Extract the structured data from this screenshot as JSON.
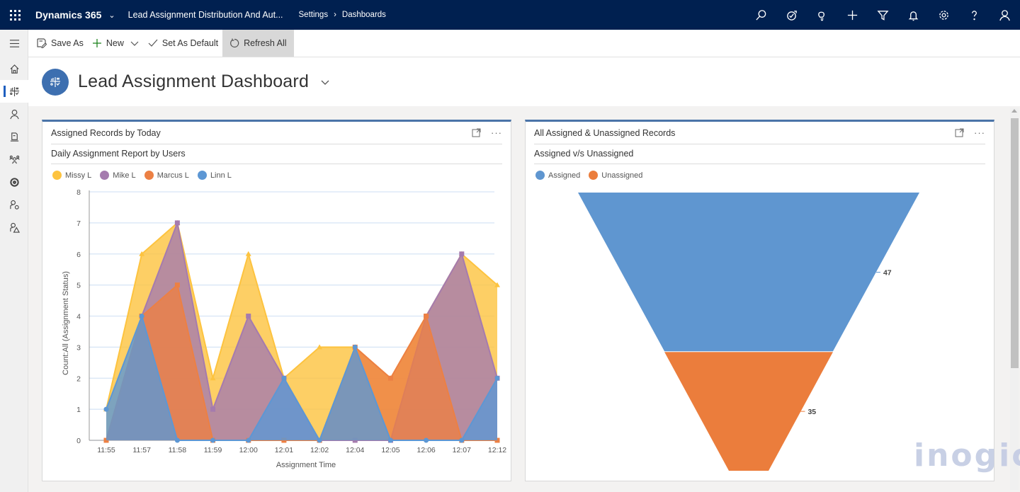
{
  "topbar": {
    "app_name": "Dynamics 365",
    "app_title": "Lead Assignment Distribution And Aut...",
    "breadcrumb": [
      "Settings",
      "Dashboards"
    ],
    "icons": [
      "search-icon",
      "task-icon",
      "lightbulb-icon",
      "plus-icon",
      "filter-icon",
      "bell-icon",
      "gear-icon",
      "help-icon",
      "user-icon"
    ]
  },
  "leftnav": {
    "items": [
      "hamburger-icon",
      "home-icon",
      "dashboard-icon",
      "contact-icon",
      "document-icon",
      "team-icon",
      "security-icon",
      "user-settings-icon",
      "user-warning-icon"
    ]
  },
  "commandbar": {
    "save_as": "Save As",
    "new": "New",
    "set_default": "Set As Default",
    "refresh_all": "Refresh All"
  },
  "header": {
    "title": "Lead Assignment Dashboard"
  },
  "panels": [
    {
      "title": "Assigned Records by Today",
      "subtitle": "Daily Assignment Report by Users"
    },
    {
      "title": "All Assigned & Unassigned Records",
      "subtitle": "Assigned v/s Unassigned"
    }
  ],
  "watermark": "inogic",
  "chart_data": [
    {
      "type": "area",
      "title": "Daily Assignment Report by Users",
      "xlabel": "Assignment Time",
      "ylabel": "Count:All (Assignment Status)",
      "ylim": [
        0,
        8
      ],
      "yticks": [
        0,
        1,
        2,
        3,
        4,
        5,
        6,
        7,
        8
      ],
      "grid": true,
      "legend_position": "top-left",
      "categories": [
        "11:55",
        "11:57",
        "11:58",
        "11:59",
        "12:00",
        "12:01",
        "12:02",
        "12:04",
        "12:05",
        "12:06",
        "12:07",
        "12:12"
      ],
      "series": [
        {
          "name": "Missy L",
          "color": "#fdc33f",
          "marker": "triangle",
          "values": [
            1,
            6,
            7,
            2,
            6,
            2,
            3,
            3,
            2,
            4,
            6,
            5
          ]
        },
        {
          "name": "Mike L",
          "color": "#a57bae",
          "marker": "square",
          "values": [
            0,
            4,
            7,
            1,
            4,
            2,
            0,
            0,
            0,
            4,
            6,
            2
          ]
        },
        {
          "name": "Marcus L",
          "color": "#ec8044",
          "marker": "square",
          "values": [
            0,
            4,
            5,
            0,
            0,
            0,
            0,
            3,
            2,
            4,
            0,
            0
          ]
        },
        {
          "name": "Linn L",
          "color": "#5d97d4",
          "marker": "circle",
          "values": [
            1,
            4,
            0,
            0,
            0,
            2,
            0,
            3,
            0,
            0,
            0,
            2
          ]
        }
      ]
    },
    {
      "type": "funnel",
      "title": "Assigned v/s Unassigned",
      "legend_position": "top-left",
      "categories": [
        "Assigned",
        "Unassigned"
      ],
      "values": [
        47,
        35
      ],
      "colors": [
        "#5f96d0",
        "#eb7d3c"
      ]
    }
  ]
}
